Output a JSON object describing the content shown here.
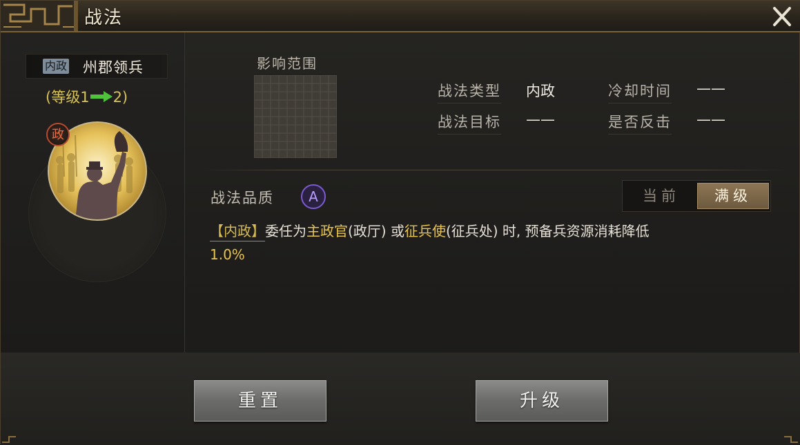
{
  "window": {
    "title": "战法"
  },
  "skill": {
    "type_tag": "内政",
    "name": "州郡领兵",
    "level_prefix": "(等级1",
    "level_suffix": "2)",
    "badge": "政"
  },
  "range": {
    "label": "影响范围"
  },
  "info": {
    "type_label": "战法类型",
    "type_value": "内政",
    "cooldown_label": "冷却时间",
    "cooldown_value": "——",
    "target_label": "战法目标",
    "target_value": "——",
    "counter_label": "是否反击",
    "counter_value": "——"
  },
  "quality": {
    "label": "战法品质",
    "grade": "A"
  },
  "toggle": {
    "current": "当前",
    "max": "满级"
  },
  "description": {
    "tag": "【内政】",
    "part1": "委任为",
    "hl1": "主政官",
    "part2": "(政厅) 或",
    "hl2": "征兵使",
    "part3": "(征兵处) 时, 预备兵资源消耗降低",
    "value": "1.0%"
  },
  "buttons": {
    "reset": "重置",
    "upgrade": "升级"
  },
  "colors": {
    "accent_gold": "#e8c54e",
    "level_green": "#4fc43a",
    "badge_red": "#b64b2f",
    "quality_purple": "#7c5bd3"
  },
  "icons": {
    "close": "close-icon",
    "level_arrow": "right-arrow-icon",
    "quality": "grade-a-icon"
  }
}
